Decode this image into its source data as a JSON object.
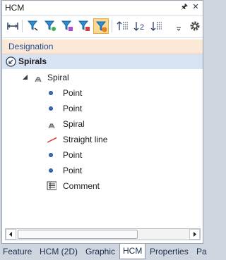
{
  "window": {
    "title": "HCM"
  },
  "header": {
    "designation_label": "Designation"
  },
  "tree": {
    "root_label": "Spirals",
    "group_label": "Spiral",
    "items": [
      {
        "label": "Point",
        "icon": "point-icon"
      },
      {
        "label": "Point",
        "icon": "point-icon"
      },
      {
        "label": "Spiral",
        "icon": "spiral-icon"
      },
      {
        "label": "Straight line",
        "icon": "line-icon"
      },
      {
        "label": "Point",
        "icon": "point-icon"
      },
      {
        "label": "Point",
        "icon": "point-icon"
      },
      {
        "label": "Comment",
        "icon": "comment-icon"
      }
    ]
  },
  "tabs": [
    "Feature",
    "HCM (2D)",
    "Graphic",
    "HCM",
    "Properties",
    "Pa"
  ],
  "active_tab": "HCM",
  "colors": {
    "header_bg": "#fbe8d6",
    "header_text": "#1d4f9a",
    "selected_row": "#d7e3f3",
    "active_tool": "#fbd997"
  }
}
